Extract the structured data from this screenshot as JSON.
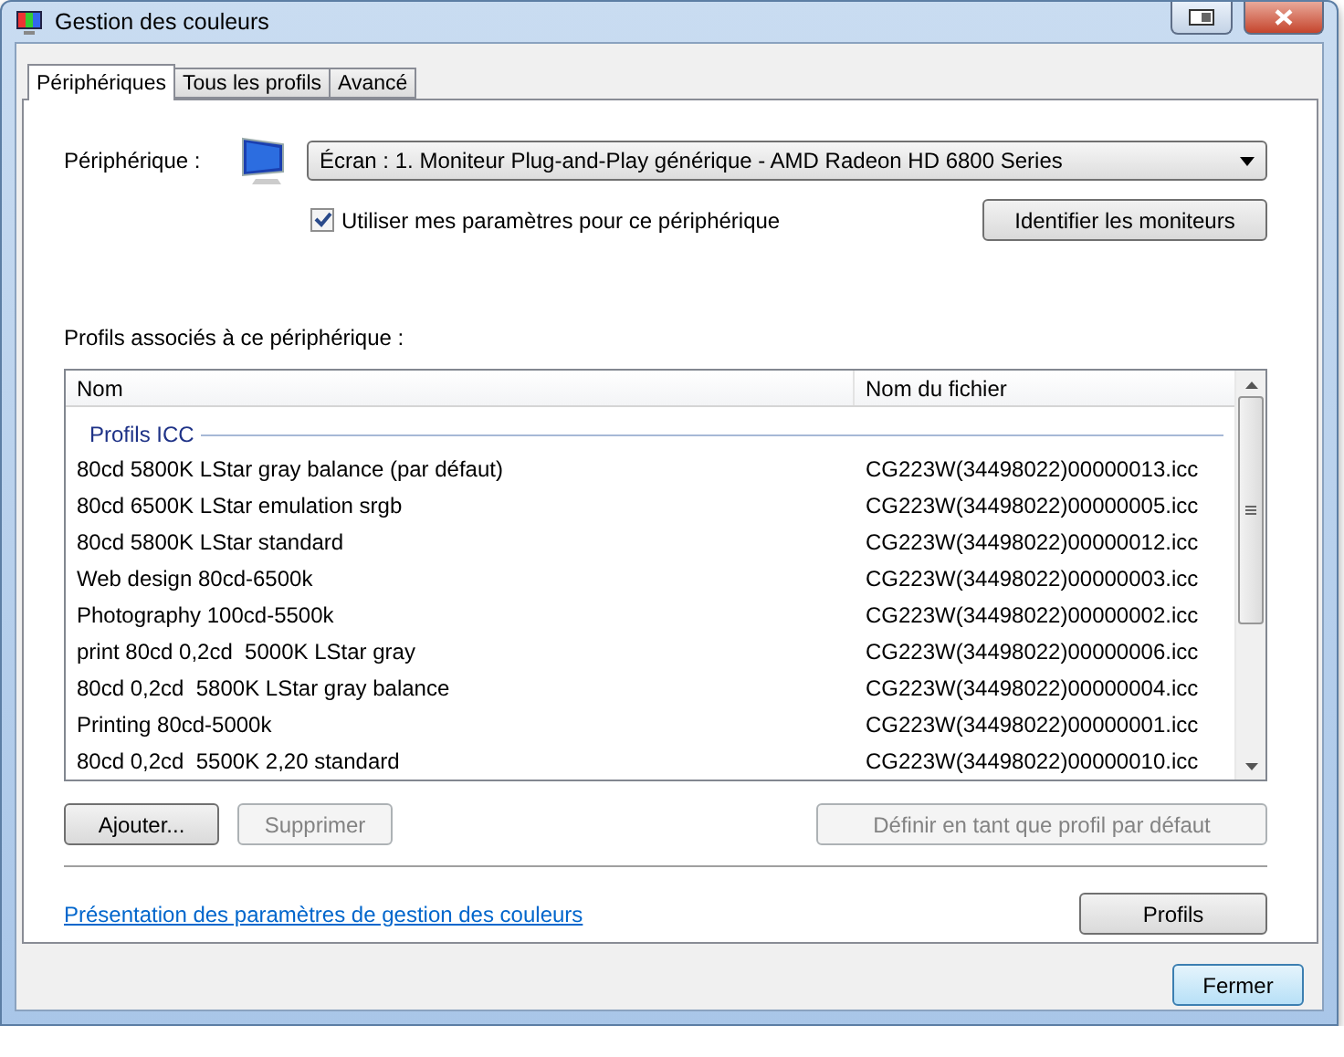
{
  "window": {
    "title": "Gestion des couleurs"
  },
  "tabs": [
    {
      "label": "Périphériques",
      "selected": true
    },
    {
      "label": "Tous les profils",
      "selected": false
    },
    {
      "label": "Avancé",
      "selected": false
    }
  ],
  "device": {
    "label": "Périphérique :",
    "value": "Écran : 1. Moniteur Plug-and-Play générique - AMD Radeon HD 6800 Series"
  },
  "use_settings": {
    "label": "Utiliser mes paramètres pour ce périphérique",
    "checked": true
  },
  "identify_button": {
    "label": "Identifier les moniteurs",
    "disabled": false
  },
  "profiles_label": "Profils associés à ce périphérique :",
  "table": {
    "columns": [
      "Nom",
      "Nom du fichier"
    ],
    "group": "Profils ICC",
    "rows": [
      {
        "name": "80cd 5800K LStar gray balance (par défaut)",
        "file": "CG223W(34498022)00000013.icc"
      },
      {
        "name": "80cd 6500K LStar emulation srgb",
        "file": "CG223W(34498022)00000005.icc"
      },
      {
        "name": "80cd 5800K LStar standard",
        "file": "CG223W(34498022)00000012.icc"
      },
      {
        "name": "Web design 80cd-6500k",
        "file": "CG223W(34498022)00000003.icc"
      },
      {
        "name": "Photography 100cd-5500k",
        "file": "CG223W(34498022)00000002.icc"
      },
      {
        "name": "print 80cd 0,2cd  5000K LStar gray",
        "file": "CG223W(34498022)00000006.icc"
      },
      {
        "name": "80cd 0,2cd  5800K LStar gray balance",
        "file": "CG223W(34498022)00000004.icc"
      },
      {
        "name": "Printing 80cd-5000k",
        "file": "CG223W(34498022)00000001.icc"
      },
      {
        "name": "80cd 0,2cd  5500K 2,20 standard",
        "file": "CG223W(34498022)00000010.icc"
      }
    ]
  },
  "list_buttons": [
    {
      "label": "Ajouter...",
      "disabled": false
    },
    {
      "label": "Supprimer",
      "disabled": true
    },
    {
      "label": "Définir en tant que profil par défaut",
      "disabled": true
    }
  ],
  "link": "Présentation des paramètres de gestion des couleurs",
  "profiles_button": {
    "label": "Profils",
    "disabled": false
  },
  "close_button": {
    "label": "Fermer",
    "disabled": false
  }
}
